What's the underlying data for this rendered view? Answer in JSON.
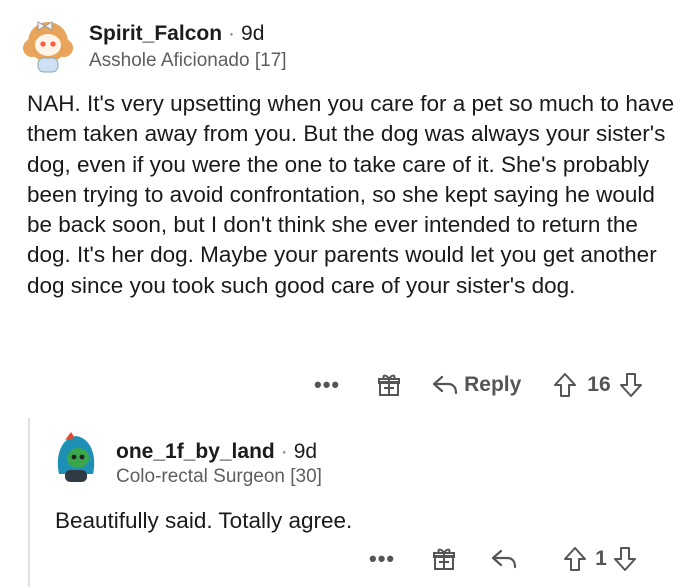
{
  "comments": [
    {
      "username": "Spirit_Falcon",
      "separator": "·",
      "age": "9d",
      "flair": "Asshole Aficionado",
      "karma": "[17]",
      "body": "NAH. It's very upsetting when you care for a pet so much to have them taken away from you. But the dog was always your sister's dog, even if you were the one to take care of it. She's probably been trying to avoid confrontation, so she kept saying he would be back soon, but I don't think she ever intended to return the dog. It's her dog. Maybe your parents would let you get another dog since you took such good care of your sister's dog.",
      "more": "•••",
      "reply_label": "Reply",
      "score": "16"
    },
    {
      "username": "one_1f_by_land",
      "separator": "·",
      "age": "9d",
      "flair": "Colo-rectal Surgeon",
      "karma": "[30]",
      "body": "Beautifully said. Totally agree.",
      "more": "•••",
      "score": "1"
    }
  ],
  "icons": {
    "avatar1": "snoo-avatar-icon",
    "avatar2": "snoo-avatar-icon",
    "award": "gift-icon",
    "reply": "reply-arrow-icon",
    "upvote": "upvote-arrow-icon",
    "downvote": "downvote-arrow-icon"
  },
  "colors": {
    "text": "#1c1c1c",
    "muted": "#5e5e5e",
    "thread": "#e0e0e0"
  }
}
